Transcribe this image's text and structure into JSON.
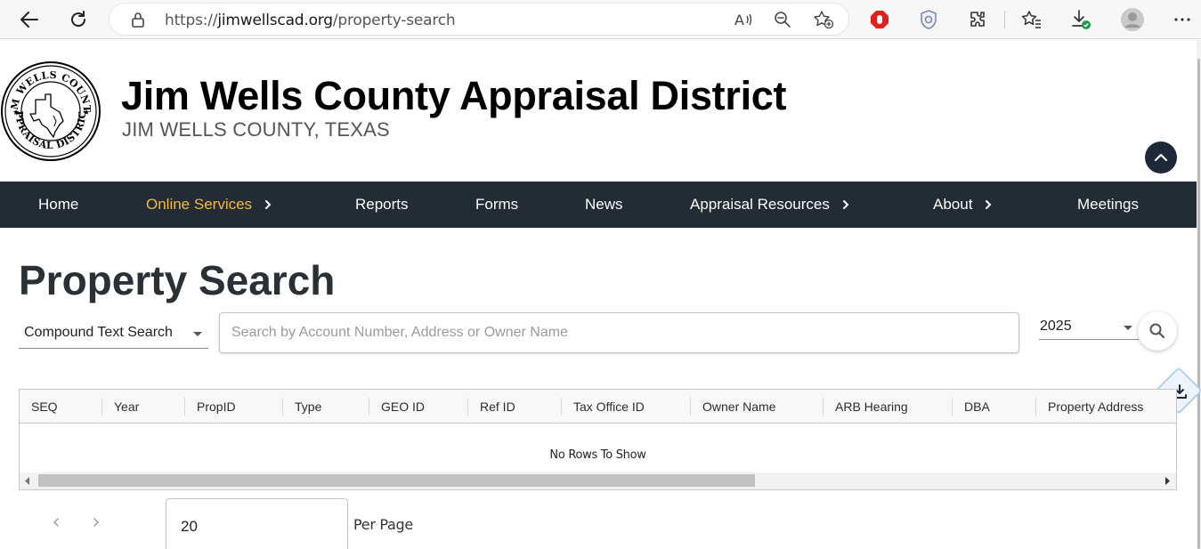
{
  "browser": {
    "url_scheme": "https://",
    "url_host": "jimwellscad.org",
    "url_path": "/property-search"
  },
  "header": {
    "title": "Jim Wells County Appraisal District",
    "subtitle": "JIM WELLS COUNTY, TEXAS",
    "seal_text": "JIM WELLS COUNTY APPRAISAL DISTRICT"
  },
  "nav": {
    "items": [
      {
        "label": "Home",
        "active": false,
        "has_submenu": false
      },
      {
        "label": "Online Services",
        "active": true,
        "has_submenu": true
      },
      {
        "label": "Reports",
        "active": false,
        "has_submenu": false
      },
      {
        "label": "Forms",
        "active": false,
        "has_submenu": false
      },
      {
        "label": "News",
        "active": false,
        "has_submenu": false
      },
      {
        "label": "Appraisal Resources",
        "active": false,
        "has_submenu": true
      },
      {
        "label": "About",
        "active": false,
        "has_submenu": true
      },
      {
        "label": "Meetings",
        "active": false,
        "has_submenu": false
      }
    ]
  },
  "search": {
    "page_title": "Property Search",
    "search_type": "Compound Text Search",
    "placeholder": "Search by Account Number, Address or Owner Name",
    "value": "",
    "year": "2025"
  },
  "grid": {
    "columns": [
      "SEQ",
      "Year",
      "PropID",
      "Type",
      "GEO ID",
      "Ref ID",
      "Tax Office ID",
      "Owner Name",
      "ARB Hearing",
      "DBA",
      "Property Address"
    ],
    "empty_message": "No Rows To Show"
  },
  "pagination": {
    "per_page": "20",
    "per_page_label": "Per Page"
  },
  "colors": {
    "nav_bg": "#232b35",
    "nav_active": "#f5b942",
    "title_text": "#2b2f36"
  }
}
